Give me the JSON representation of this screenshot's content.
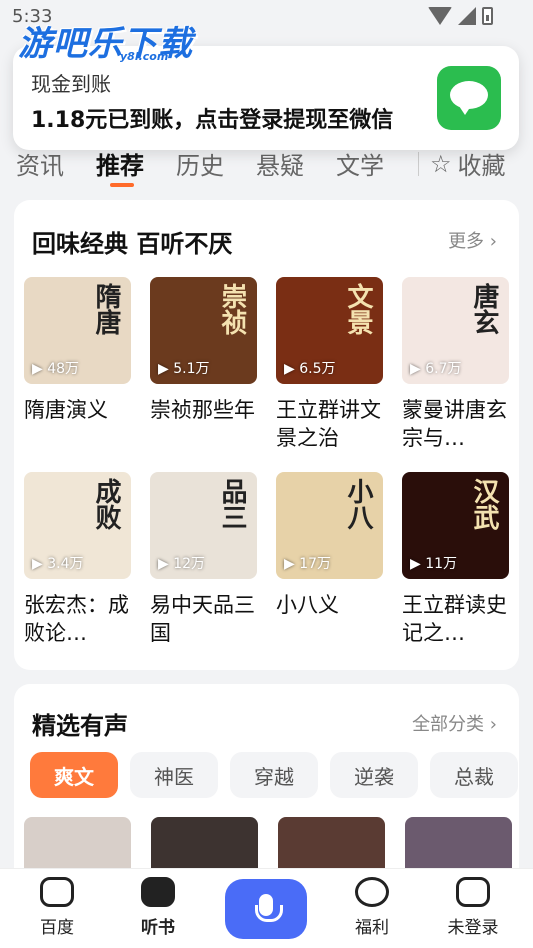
{
  "status_bar": {
    "time": "5:33"
  },
  "watermark": {
    "logo": "游吧乐下载",
    "domain": "y8l.com"
  },
  "notification": {
    "title": "现金到账",
    "body": "1.18元已到账，点击登录提现至微信",
    "icon": "wechat-icon"
  },
  "tabs": [
    {
      "label": "资讯"
    },
    {
      "label": "推荐"
    },
    {
      "label": "历史"
    },
    {
      "label": "悬疑"
    },
    {
      "label": "文学"
    }
  ],
  "favorites_label": "收藏",
  "section1": {
    "title": "回味经典 百听不厌",
    "more": "更多",
    "books": [
      {
        "title": "隋唐演义",
        "count": "48万",
        "cover_text": "隋唐",
        "color": "#e8d9c4"
      },
      {
        "title": "崇祯那些年",
        "count": "5.1万",
        "cover_text": "崇祯",
        "color": "#6b3a1e"
      },
      {
        "title": "王立群讲文景之治",
        "count": "6.5万",
        "cover_text": "文景",
        "color": "#7a2e14"
      },
      {
        "title": "蒙曼讲唐玄宗与…",
        "count": "6.7万",
        "cover_text": "唐玄",
        "color": "#f3e7e2"
      },
      {
        "title": "张宏杰：成败论…",
        "count": "3.4万",
        "cover_text": "成败",
        "color": "#f0e6d6"
      },
      {
        "title": "易中天品三国",
        "count": "12万",
        "cover_text": "品三",
        "color": "#e9e2d8"
      },
      {
        "title": "小八义",
        "count": "17万",
        "cover_text": "小八",
        "color": "#e7d2a8"
      },
      {
        "title": "王立群读史记之…",
        "count": "11万",
        "cover_text": "汉武",
        "color": "#2a0e0a"
      }
    ]
  },
  "section2": {
    "title": "精选有声",
    "more": "全部分类",
    "chips": [
      "爽文",
      "神医",
      "穿越",
      "逆袭",
      "总裁"
    ],
    "cover_colors": [
      "#d8cfc9",
      "#3d3330",
      "#5a3b33",
      "#6b5a6e"
    ]
  },
  "bottom_nav": {
    "items": [
      {
        "label": "百度"
      },
      {
        "label": "听书"
      },
      {
        "label": "福利"
      },
      {
        "label": "未登录"
      }
    ]
  },
  "colors": {
    "accent": "#ff6a2a",
    "mic": "#4a6cf7",
    "wechat": "#2bbd4f"
  }
}
